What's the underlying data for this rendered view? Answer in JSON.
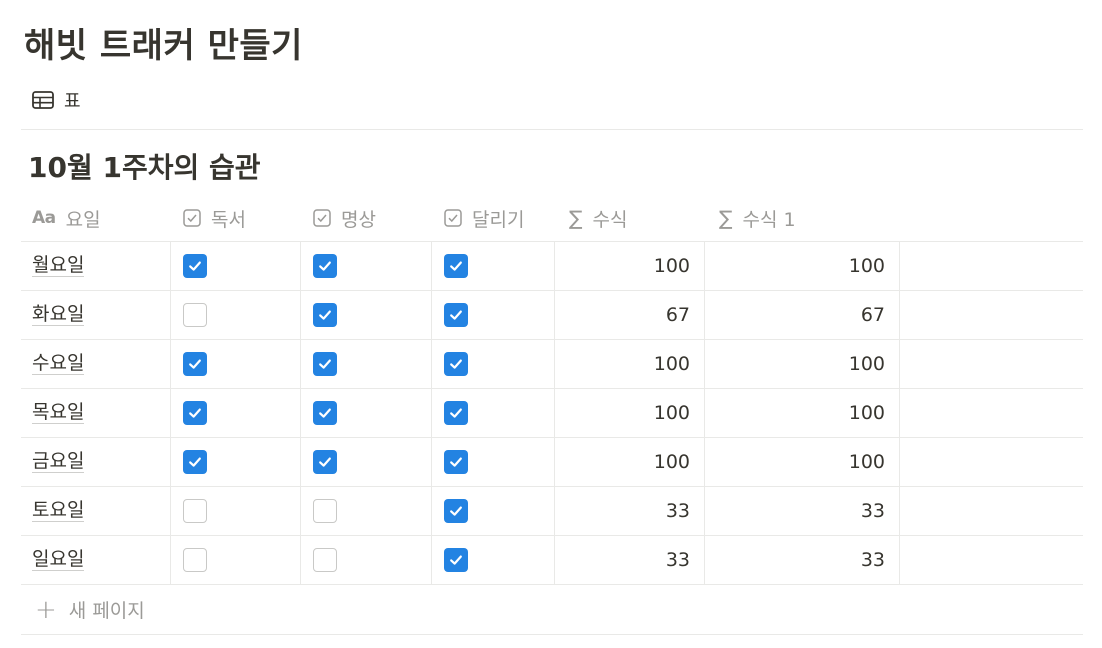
{
  "page": {
    "title": "해빗 트래커 만들기"
  },
  "view": {
    "icon": "table-icon",
    "label": "표"
  },
  "database": {
    "title": "10월 1주차의 습관",
    "columns": [
      {
        "icon": "Aa",
        "label": "요일",
        "type": "title"
      },
      {
        "icon": "checkbox-icon",
        "label": "독서",
        "type": "checkbox"
      },
      {
        "icon": "checkbox-icon",
        "label": "명상",
        "type": "checkbox"
      },
      {
        "icon": "checkbox-icon",
        "label": "달리기",
        "type": "checkbox"
      },
      {
        "icon": "∑",
        "label": "수식",
        "type": "formula"
      },
      {
        "icon": "∑",
        "label": "수식 1",
        "type": "formula"
      }
    ],
    "rows": [
      {
        "day": "월요일",
        "checks": [
          true,
          true,
          true
        ],
        "formula": "100",
        "formula1": "100"
      },
      {
        "day": "화요일",
        "checks": [
          false,
          true,
          true
        ],
        "formula": "67",
        "formula1": "67"
      },
      {
        "day": "수요일",
        "checks": [
          true,
          true,
          true
        ],
        "formula": "100",
        "formula1": "100"
      },
      {
        "day": "목요일",
        "checks": [
          true,
          true,
          true
        ],
        "formula": "100",
        "formula1": "100"
      },
      {
        "day": "금요일",
        "checks": [
          true,
          true,
          true
        ],
        "formula": "100",
        "formula1": "100"
      },
      {
        "day": "토요일",
        "checks": [
          false,
          false,
          true
        ],
        "formula": "33",
        "formula1": "33"
      },
      {
        "day": "일요일",
        "checks": [
          false,
          false,
          true
        ],
        "formula": "33",
        "formula1": "33"
      }
    ],
    "new_page_label": "새 페이지"
  },
  "colors": {
    "checkbox_checked": "#2383e2",
    "text": "#37352f",
    "muted": "#9b9a97",
    "divider": "#e9e9e7"
  }
}
